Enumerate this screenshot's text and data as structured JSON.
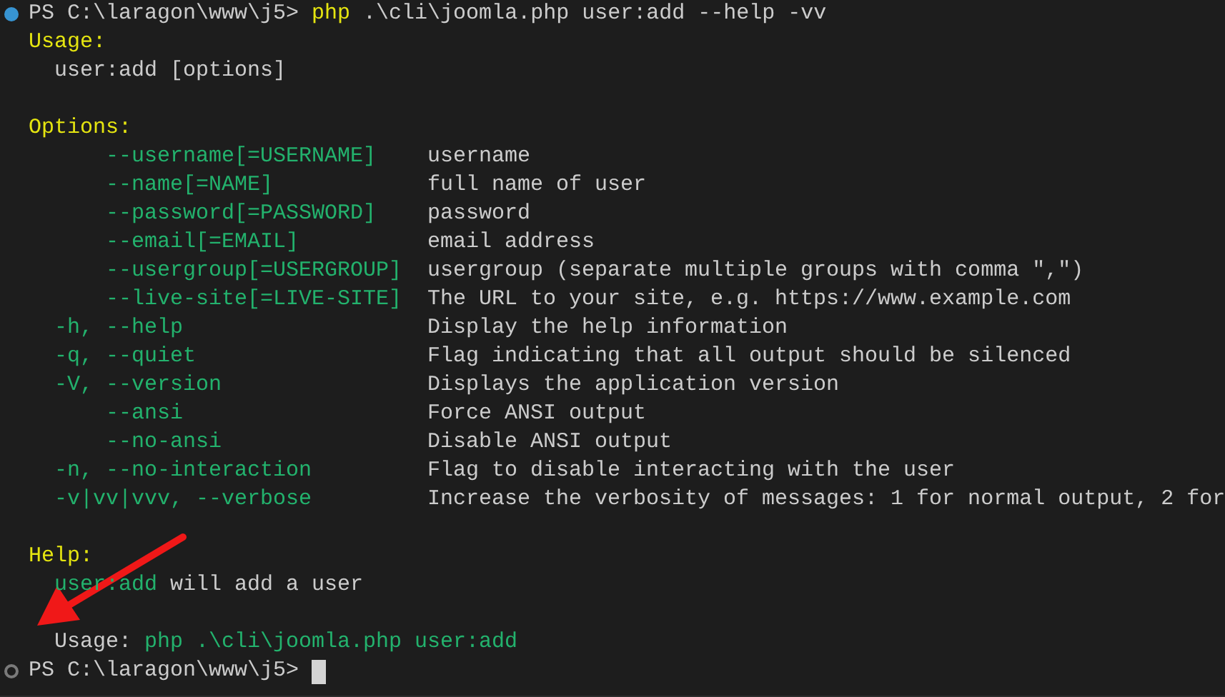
{
  "terminal": {
    "command_line": {
      "filled": true,
      "prompt": "PS C:\\laragon\\www\\j5>",
      "program": "php",
      "arguments": ".\\cli\\joomla.php user:add --help -vv"
    },
    "usage": {
      "heading": "Usage:",
      "text": "user:add [options]"
    },
    "options": {
      "heading": "Options:",
      "items": [
        {
          "kind": "long-only",
          "option": "--username[=USERNAME]",
          "description": "username"
        },
        {
          "kind": "long-only",
          "option": "--name[=NAME]",
          "description": "full name of user"
        },
        {
          "kind": "long-only",
          "option": "--password[=PASSWORD]",
          "description": "password"
        },
        {
          "kind": "long-only",
          "option": "--email[=EMAIL]",
          "description": "email address"
        },
        {
          "kind": "long-only",
          "option": "--usergroup[=USERGROUP]",
          "description": "usergroup (separate multiple groups with comma \",\")"
        },
        {
          "kind": "long-only",
          "option": "--live-site[=LIVE-SITE]",
          "description": "The URL to your site, e.g. https://www.example.com"
        },
        {
          "kind": "short-and-long",
          "option": "-h, --help",
          "description": "Display the help information"
        },
        {
          "kind": "short-and-long",
          "option": "-q, --quiet",
          "description": "Flag indicating that all output should be silenced"
        },
        {
          "kind": "short-and-long",
          "option": "-V, --version",
          "description": "Displays the application version"
        },
        {
          "kind": "long-only",
          "option": "--ansi",
          "description": "Force ANSI output"
        },
        {
          "kind": "long-only",
          "option": "--no-ansi",
          "description": "Disable ANSI output"
        },
        {
          "kind": "short-and-long",
          "option": "-n, --no-interaction",
          "description": "Flag to disable interacting with the user"
        },
        {
          "kind": "short-and-long",
          "option": "-v|vv|vvv, --verbose",
          "description": "Increase the verbosity of messages: 1 for normal output, 2 for"
        }
      ]
    },
    "help": {
      "heading": "Help:",
      "command": "user:add",
      "text": "will add a user",
      "usage_label": "Usage:",
      "usage_command": "php .\\cli\\joomla.php user:add"
    },
    "prompt_line": {
      "filled": false,
      "prompt": "PS C:\\laragon\\www\\j5>"
    }
  }
}
